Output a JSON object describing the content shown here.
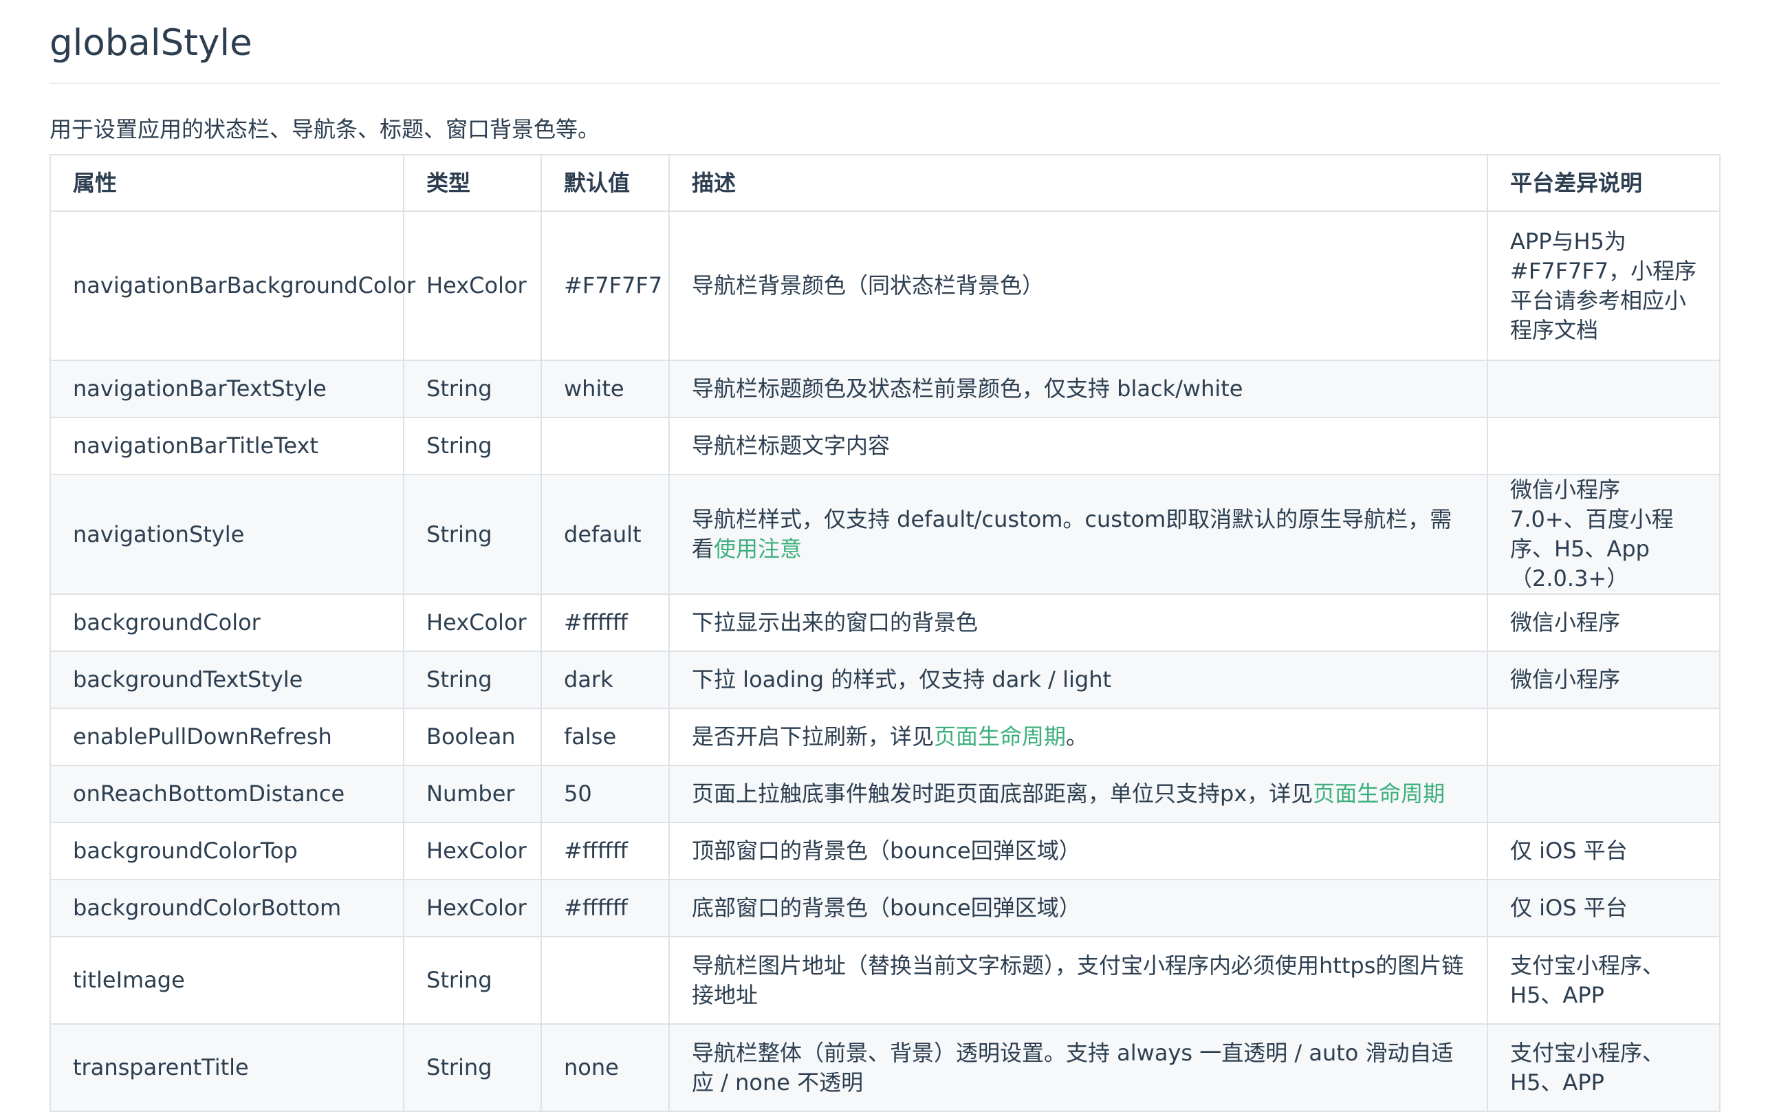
{
  "page": {
    "title": "globalStyle",
    "intro": "用于设置应用的状态栏、导航条、标题、窗口背景色等。"
  },
  "table": {
    "headers": [
      "属性",
      "类型",
      "默认值",
      "描述",
      "平台差异说明"
    ],
    "rows": [
      {
        "prop": "navigationBarBackgroundColor",
        "type": "HexColor",
        "default": "#F7F7F7",
        "desc": "导航栏背景颜色（同状态栏背景色）",
        "platform": "APP与H5为#F7F7F7，小程序平台请参考相应小程序文档"
      },
      {
        "prop": "navigationBarTextStyle",
        "type": "String",
        "default": "white",
        "desc": "导航栏标题颜色及状态栏前景颜色，仅支持 black/white",
        "platform": ""
      },
      {
        "prop": "navigationBarTitleText",
        "type": "String",
        "default": "",
        "desc": "导航栏标题文字内容",
        "platform": ""
      },
      {
        "prop": "navigationStyle",
        "type": "String",
        "default": "default",
        "desc": "导航栏样式，仅支持 default/custom。custom即取消默认的原生导航栏，需看",
        "desc_link": "使用注意",
        "platform": "微信小程序 7.0+、百度小程序、H5、App（2.0.3+）"
      },
      {
        "prop": "backgroundColor",
        "type": "HexColor",
        "default": "#ffffff",
        "desc": "下拉显示出来的窗口的背景色",
        "platform": "微信小程序"
      },
      {
        "prop": "backgroundTextStyle",
        "type": "String",
        "default": "dark",
        "desc": "下拉 loading 的样式，仅支持 dark / light",
        "platform": "微信小程序"
      },
      {
        "prop": "enablePullDownRefresh",
        "type": "Boolean",
        "default": "false",
        "desc": "是否开启下拉刷新，详见",
        "desc_link": "页面生命周期",
        "desc_after": "。",
        "platform": ""
      },
      {
        "prop": "onReachBottomDistance",
        "type": "Number",
        "default": "50",
        "desc": "页面上拉触底事件触发时距页面底部距离，单位只支持px，详见",
        "desc_link": "页面生命周期",
        "platform": ""
      },
      {
        "prop": "backgroundColorTop",
        "type": "HexColor",
        "default": "#ffffff",
        "desc": "顶部窗口的背景色（bounce回弹区域）",
        "platform": "仅 iOS 平台"
      },
      {
        "prop": "backgroundColorBottom",
        "type": "HexColor",
        "default": "#ffffff",
        "desc": "底部窗口的背景色（bounce回弹区域）",
        "platform": "仅 iOS 平台"
      },
      {
        "prop": "titleImage",
        "type": "String",
        "default": "",
        "desc": "导航栏图片地址（替换当前文字标题），支付宝小程序内必须使用https的图片链接地址",
        "platform": "支付宝小程序、H5、APP"
      },
      {
        "prop": "transparentTitle",
        "type": "String",
        "default": "none",
        "desc": "导航栏整体（前景、背景）透明设置。支持 always 一直透明 / auto 滑动自适应 / none 不透明",
        "platform": "支付宝小程序、H5、APP"
      }
    ]
  }
}
